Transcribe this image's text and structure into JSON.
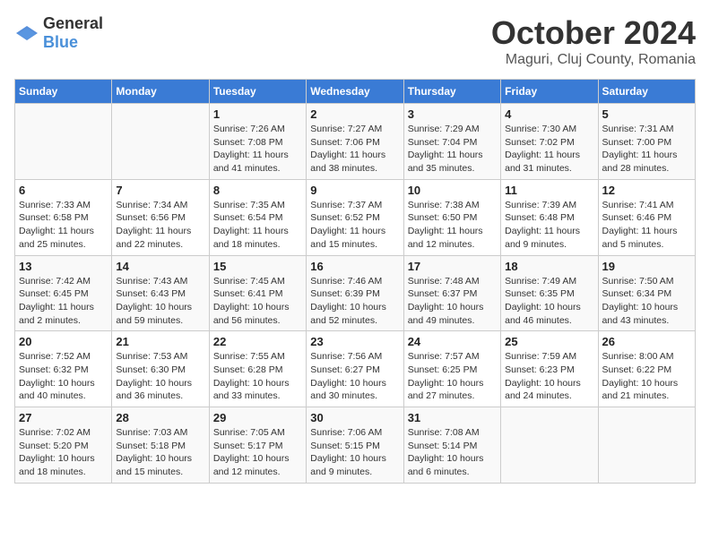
{
  "header": {
    "logo": {
      "general": "General",
      "blue": "Blue"
    },
    "title": "October 2024",
    "location": "Maguri, Cluj County, Romania"
  },
  "days_of_week": [
    "Sunday",
    "Monday",
    "Tuesday",
    "Wednesday",
    "Thursday",
    "Friday",
    "Saturday"
  ],
  "weeks": [
    [
      {
        "day": "",
        "info": ""
      },
      {
        "day": "",
        "info": ""
      },
      {
        "day": "1",
        "info": "Sunrise: 7:26 AM\nSunset: 7:08 PM\nDaylight: 11 hours and 41 minutes."
      },
      {
        "day": "2",
        "info": "Sunrise: 7:27 AM\nSunset: 7:06 PM\nDaylight: 11 hours and 38 minutes."
      },
      {
        "day": "3",
        "info": "Sunrise: 7:29 AM\nSunset: 7:04 PM\nDaylight: 11 hours and 35 minutes."
      },
      {
        "day": "4",
        "info": "Sunrise: 7:30 AM\nSunset: 7:02 PM\nDaylight: 11 hours and 31 minutes."
      },
      {
        "day": "5",
        "info": "Sunrise: 7:31 AM\nSunset: 7:00 PM\nDaylight: 11 hours and 28 minutes."
      }
    ],
    [
      {
        "day": "6",
        "info": "Sunrise: 7:33 AM\nSunset: 6:58 PM\nDaylight: 11 hours and 25 minutes."
      },
      {
        "day": "7",
        "info": "Sunrise: 7:34 AM\nSunset: 6:56 PM\nDaylight: 11 hours and 22 minutes."
      },
      {
        "day": "8",
        "info": "Sunrise: 7:35 AM\nSunset: 6:54 PM\nDaylight: 11 hours and 18 minutes."
      },
      {
        "day": "9",
        "info": "Sunrise: 7:37 AM\nSunset: 6:52 PM\nDaylight: 11 hours and 15 minutes."
      },
      {
        "day": "10",
        "info": "Sunrise: 7:38 AM\nSunset: 6:50 PM\nDaylight: 11 hours and 12 minutes."
      },
      {
        "day": "11",
        "info": "Sunrise: 7:39 AM\nSunset: 6:48 PM\nDaylight: 11 hours and 9 minutes."
      },
      {
        "day": "12",
        "info": "Sunrise: 7:41 AM\nSunset: 6:46 PM\nDaylight: 11 hours and 5 minutes."
      }
    ],
    [
      {
        "day": "13",
        "info": "Sunrise: 7:42 AM\nSunset: 6:45 PM\nDaylight: 11 hours and 2 minutes."
      },
      {
        "day": "14",
        "info": "Sunrise: 7:43 AM\nSunset: 6:43 PM\nDaylight: 10 hours and 59 minutes."
      },
      {
        "day": "15",
        "info": "Sunrise: 7:45 AM\nSunset: 6:41 PM\nDaylight: 10 hours and 56 minutes."
      },
      {
        "day": "16",
        "info": "Sunrise: 7:46 AM\nSunset: 6:39 PM\nDaylight: 10 hours and 52 minutes."
      },
      {
        "day": "17",
        "info": "Sunrise: 7:48 AM\nSunset: 6:37 PM\nDaylight: 10 hours and 49 minutes."
      },
      {
        "day": "18",
        "info": "Sunrise: 7:49 AM\nSunset: 6:35 PM\nDaylight: 10 hours and 46 minutes."
      },
      {
        "day": "19",
        "info": "Sunrise: 7:50 AM\nSunset: 6:34 PM\nDaylight: 10 hours and 43 minutes."
      }
    ],
    [
      {
        "day": "20",
        "info": "Sunrise: 7:52 AM\nSunset: 6:32 PM\nDaylight: 10 hours and 40 minutes."
      },
      {
        "day": "21",
        "info": "Sunrise: 7:53 AM\nSunset: 6:30 PM\nDaylight: 10 hours and 36 minutes."
      },
      {
        "day": "22",
        "info": "Sunrise: 7:55 AM\nSunset: 6:28 PM\nDaylight: 10 hours and 33 minutes."
      },
      {
        "day": "23",
        "info": "Sunrise: 7:56 AM\nSunset: 6:27 PM\nDaylight: 10 hours and 30 minutes."
      },
      {
        "day": "24",
        "info": "Sunrise: 7:57 AM\nSunset: 6:25 PM\nDaylight: 10 hours and 27 minutes."
      },
      {
        "day": "25",
        "info": "Sunrise: 7:59 AM\nSunset: 6:23 PM\nDaylight: 10 hours and 24 minutes."
      },
      {
        "day": "26",
        "info": "Sunrise: 8:00 AM\nSunset: 6:22 PM\nDaylight: 10 hours and 21 minutes."
      }
    ],
    [
      {
        "day": "27",
        "info": "Sunrise: 7:02 AM\nSunset: 5:20 PM\nDaylight: 10 hours and 18 minutes."
      },
      {
        "day": "28",
        "info": "Sunrise: 7:03 AM\nSunset: 5:18 PM\nDaylight: 10 hours and 15 minutes."
      },
      {
        "day": "29",
        "info": "Sunrise: 7:05 AM\nSunset: 5:17 PM\nDaylight: 10 hours and 12 minutes."
      },
      {
        "day": "30",
        "info": "Sunrise: 7:06 AM\nSunset: 5:15 PM\nDaylight: 10 hours and 9 minutes."
      },
      {
        "day": "31",
        "info": "Sunrise: 7:08 AM\nSunset: 5:14 PM\nDaylight: 10 hours and 6 minutes."
      },
      {
        "day": "",
        "info": ""
      },
      {
        "day": "",
        "info": ""
      }
    ]
  ]
}
